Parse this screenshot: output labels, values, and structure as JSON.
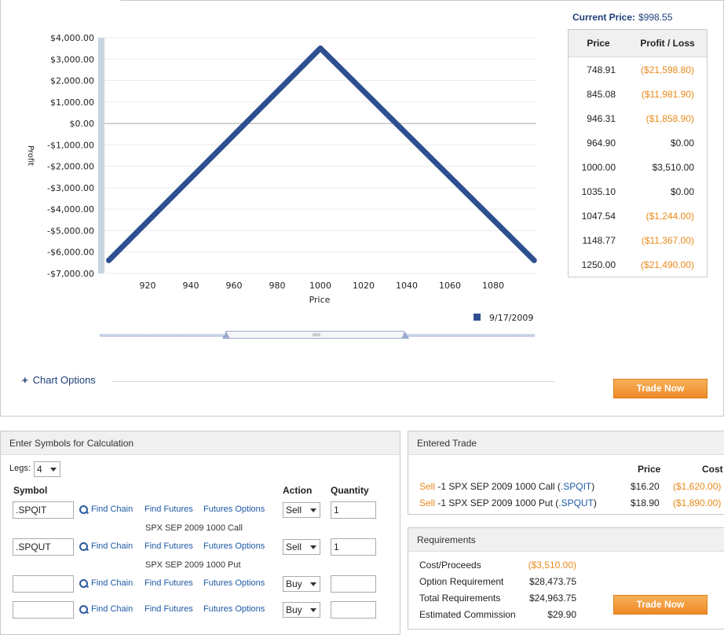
{
  "current_price": {
    "label": "Current Price:",
    "value": "$998.55"
  },
  "chart_data": {
    "type": "line",
    "xlabel": "Price",
    "ylabel": "Profit",
    "xlim": [
      900,
      1100
    ],
    "ylim": [
      -7000,
      4000
    ],
    "x_ticks": [
      "920",
      "940",
      "960",
      "980",
      "1000",
      "1020",
      "1040",
      "1060",
      "1080"
    ],
    "x_tick_values": [
      920,
      940,
      960,
      980,
      1000,
      1020,
      1040,
      1060,
      1080
    ],
    "y_ticks": [
      "$4,000.00",
      "$3,000.00",
      "$2,000.00",
      "$1,000.00",
      "$0.00",
      "-$1,000.00",
      "-$2,000.00",
      "-$3,000.00",
      "-$4,000.00",
      "-$5,000.00",
      "-$6,000.00",
      "-$7,000.00"
    ],
    "y_tick_values": [
      4000,
      3000,
      2000,
      1000,
      0,
      -1000,
      -2000,
      -3000,
      -4000,
      -5000,
      -6000,
      -7000
    ],
    "series": [
      {
        "name": "9/17/2009",
        "color": "#2e4f8f",
        "x": [
          902,
          1000,
          1099
        ],
        "y": [
          -6390,
          3510,
          -6390
        ]
      }
    ],
    "legend_position": "bottom-right",
    "grid": true
  },
  "pl_table": {
    "headers": [
      "Price",
      "Profit / Loss"
    ],
    "rows": [
      {
        "price": "748.91",
        "pl": "($21,598.80)",
        "negative": true
      },
      {
        "price": "845.08",
        "pl": "($11,981.90)",
        "negative": true
      },
      {
        "price": "946.31",
        "pl": "($1,858.90)",
        "negative": true
      },
      {
        "price": "964.90",
        "pl": "$0.00",
        "negative": false
      },
      {
        "price": "1000.00",
        "pl": "$3,510.00",
        "negative": false
      },
      {
        "price": "1035.10",
        "pl": "$0.00",
        "negative": false
      },
      {
        "price": "1047.54",
        "pl": "($1,244.00)",
        "negative": true
      },
      {
        "price": "1148.77",
        "pl": "($11,367.00)",
        "negative": true
      },
      {
        "price": "1250.00",
        "pl": "($21,490.00)",
        "negative": true
      }
    ]
  },
  "chart_options": {
    "icon": "plus-icon",
    "label": "Chart Options"
  },
  "trade_now_label": "Trade Now",
  "calc": {
    "title": "Enter Symbols for Calculation",
    "legs_label": "Legs:",
    "legs_value": "4",
    "headers": {
      "symbol": "Symbol",
      "action": "Action",
      "quantity": "Quantity"
    },
    "links": {
      "find_chain": "Find Chain",
      "find_futures": "Find Futures",
      "futures_options": "Futures Options"
    },
    "rows": [
      {
        "symbol": ".SPQIT",
        "action": "Sell",
        "quantity": "1",
        "desc": "SPX SEP 2009 1000 Call"
      },
      {
        "symbol": ".SPQUT",
        "action": "Sell",
        "quantity": "1",
        "desc": "SPX SEP 2009 1000 Put"
      },
      {
        "symbol": "",
        "action": "Buy",
        "quantity": "",
        "desc": ""
      },
      {
        "symbol": "",
        "action": "Buy",
        "quantity": "",
        "desc": ""
      }
    ]
  },
  "entered_trade": {
    "title": "Entered Trade",
    "headers": {
      "price": "Price",
      "cost": "Cost"
    },
    "rows": [
      {
        "action": "Sell",
        "desc": "-1 SPX SEP 2009 1000 Call (",
        "symbol": ".SPQIT",
        "close": ")",
        "price": "$16.20",
        "cost": "($1,620.00)"
      },
      {
        "action": "Sell",
        "desc": "-1 SPX SEP 2009 1000 Put (",
        "symbol": ".SPQUT",
        "close": ")",
        "price": "$18.90",
        "cost": "($1,890.00)"
      }
    ]
  },
  "requirements": {
    "title": "Requirements",
    "rows": [
      {
        "label": "Cost/Proceeds",
        "value": "($3,510.00)",
        "negative": true
      },
      {
        "label": "Option Requirement",
        "value": "$28,473.75",
        "negative": false
      },
      {
        "label": "Total Requirements",
        "value": "$24,963.75",
        "negative": false
      },
      {
        "label": "Estimated Commission",
        "value": "$29.90",
        "negative": false
      }
    ]
  },
  "colors": {
    "accent": "#1f3f78",
    "negative": "#e98a1a",
    "series": "#2e4f8f",
    "button": "#ef8d2a"
  }
}
